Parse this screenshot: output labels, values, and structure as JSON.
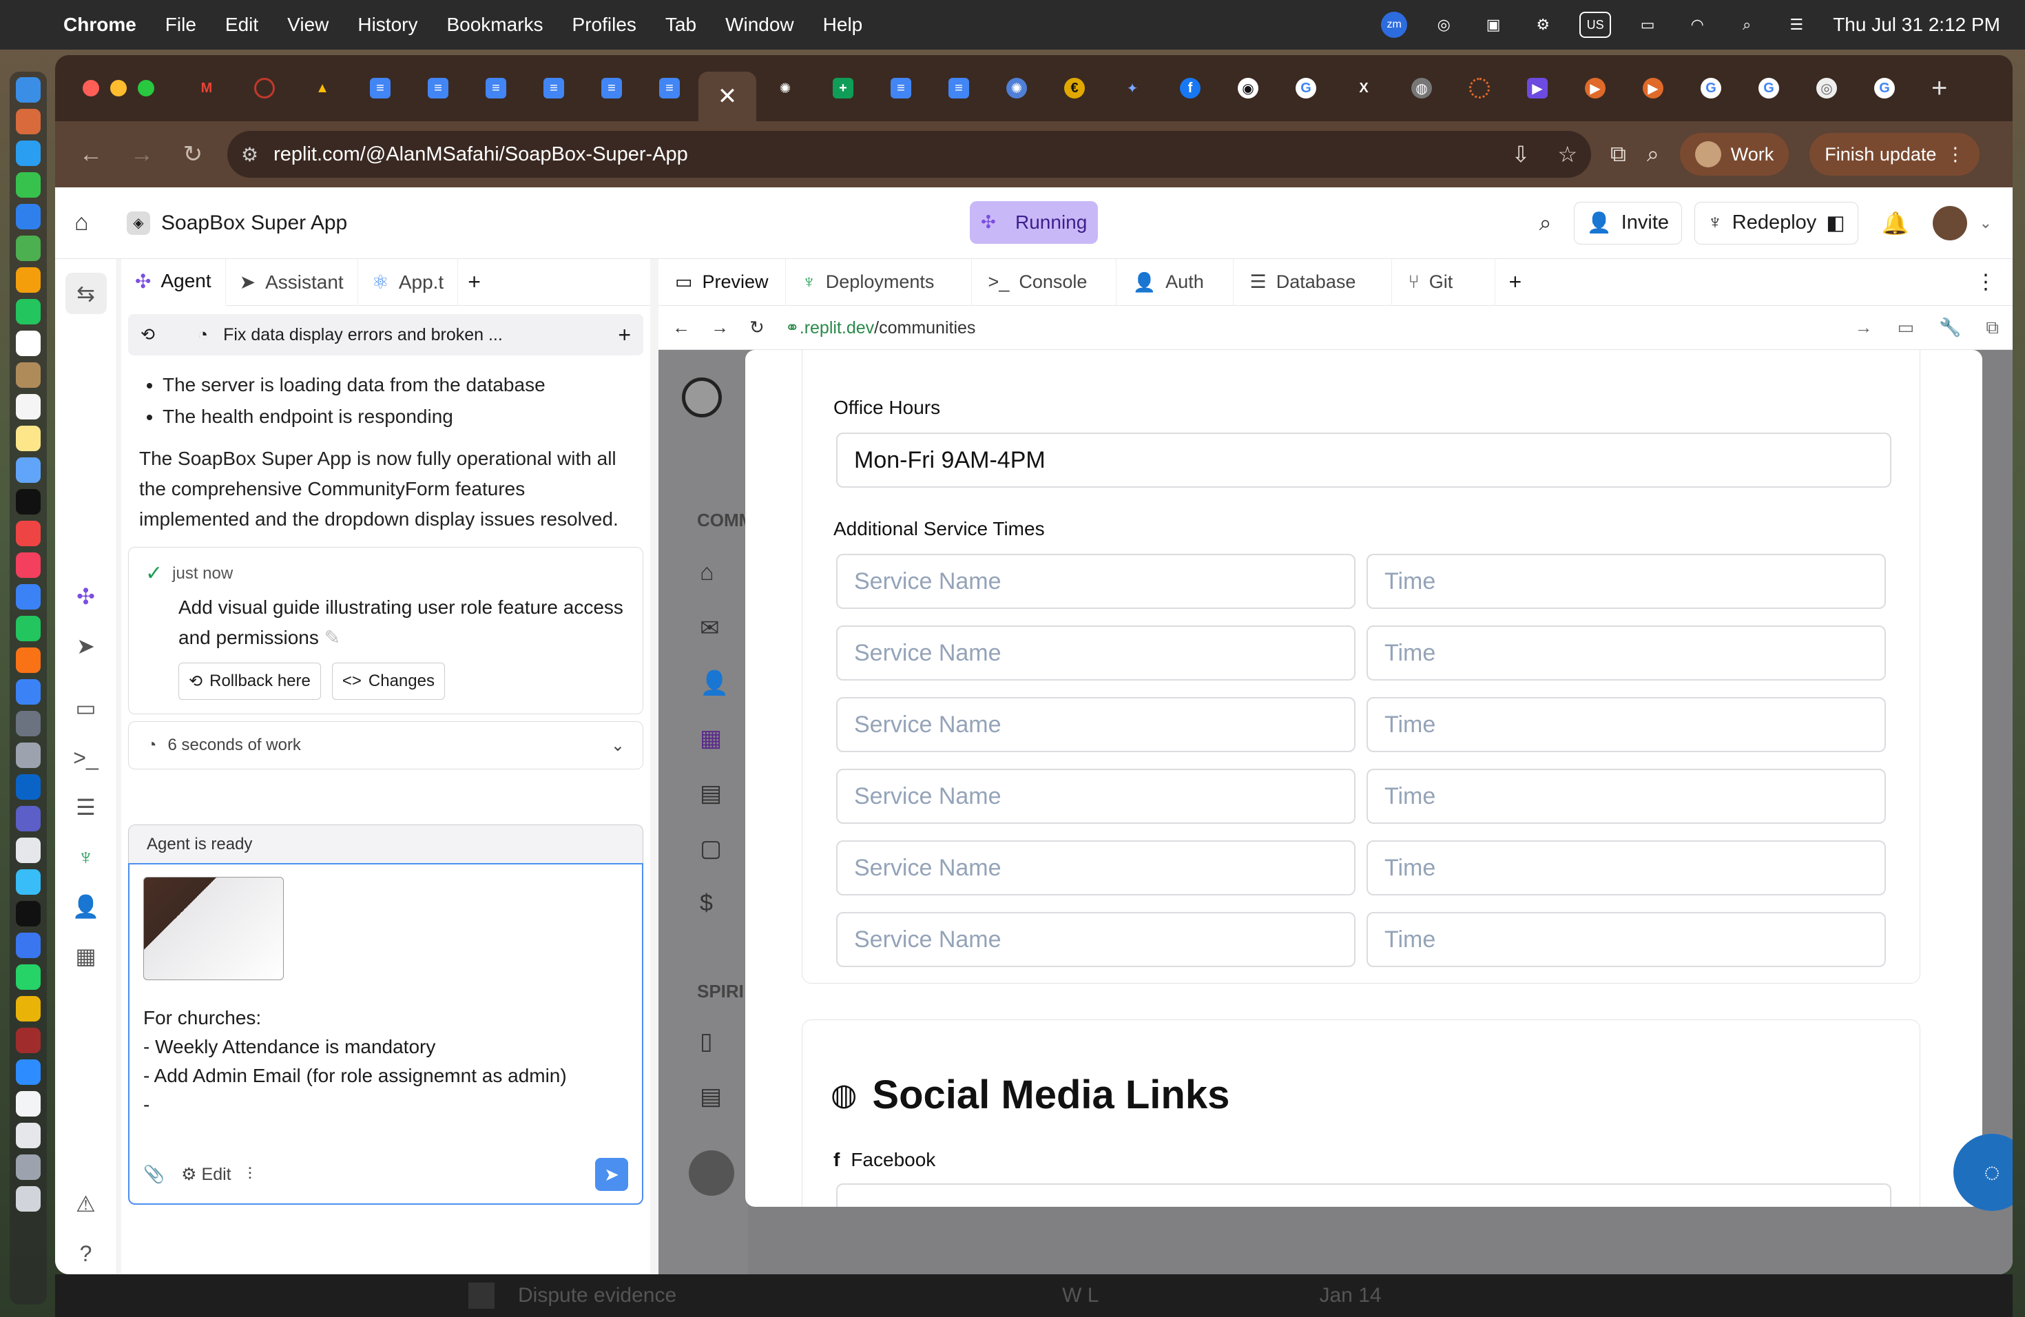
{
  "menubar": {
    "app": "Chrome",
    "items": [
      "File",
      "Edit",
      "View",
      "History",
      "Bookmarks",
      "Profiles",
      "Tab",
      "Window",
      "Help"
    ],
    "input_source": "US",
    "zoom_badge": "zm",
    "datetime": "Thu Jul 31  2:12 PM"
  },
  "browser": {
    "url": "replit.com/@AlanMSafahi/SoapBox-Super-App",
    "profile_label": "Work",
    "update_label": "Finish update",
    "new_tab_label": "+",
    "active_tab_close": "✕"
  },
  "replit": {
    "project_name": "SoapBox Super App",
    "status": "Running",
    "invite_label": "Invite",
    "redeploy_label": "Redeploy",
    "left_tabs": [
      {
        "label": "Agent"
      },
      {
        "label": "Assistant"
      },
      {
        "label": "App.t"
      }
    ],
    "right_tabs": [
      {
        "label": "Preview"
      },
      {
        "label": "Deployments"
      },
      {
        "label": "Console"
      },
      {
        "label": "Auth"
      },
      {
        "label": "Database"
      },
      {
        "label": "Git"
      }
    ]
  },
  "agent": {
    "chat_title": "Fix data display errors and broken ...",
    "bullets": [
      "The server is loading data from the database",
      "The health endpoint is responding"
    ],
    "summary": "The SoapBox Super App is now fully operational with all the comprehensive CommunityForm features implemented and the dropdown display issues resolved.",
    "checkpoint": {
      "time": "just now",
      "title": "Add visual guide illustrating user role feature access and permissions",
      "rollback_label": "Rollback here",
      "changes_label": "Changes"
    },
    "work_label": "6 seconds of work",
    "ready_label": "Agent is ready",
    "input_text": "For churches:\n- Weekly Attendance is mandatory\n- Add Admin Email (for role assignemnt as admin)\n-",
    "edit_label": "Edit"
  },
  "preview": {
    "url_domain": ".replit.dev",
    "url_path": "/communities",
    "bg_sidebar": {
      "section1": "COMM",
      "section2": "SPIRI"
    },
    "form": {
      "office_hours_label": "Office Hours",
      "office_hours_value": "Mon-Fri 9AM-4PM",
      "additional_label": "Additional Service Times",
      "service_placeholder": "Service Name",
      "time_placeholder": "Time",
      "rows": [
        1,
        2,
        3,
        4,
        5,
        6
      ],
      "social_heading": "Social Media Links",
      "facebook_label": "Facebook"
    }
  },
  "behind_window": {
    "row_text": "Dispute evidence",
    "user": "W L",
    "date": "Jan 14"
  }
}
